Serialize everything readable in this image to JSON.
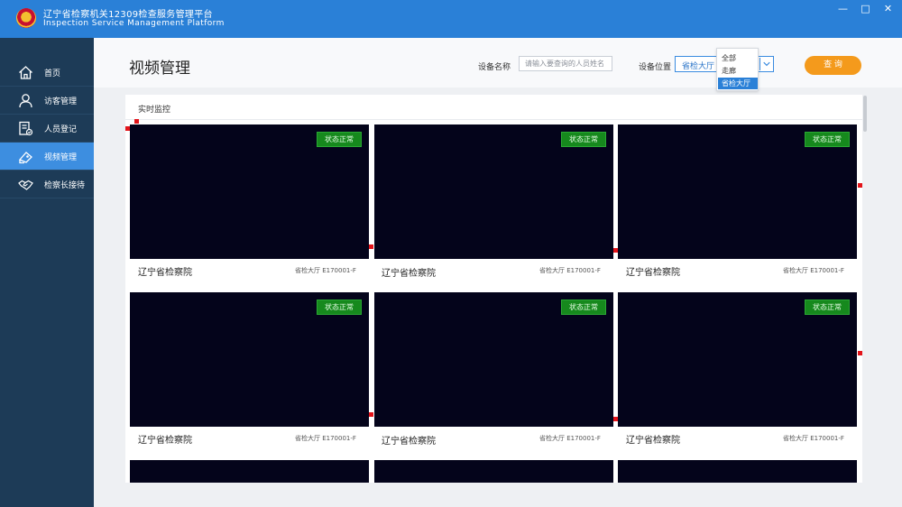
{
  "app": {
    "title_cn": "辽宁省检察机关12309检查服务管理平台",
    "title_en": "Inspection Service Management Platform",
    "window_controls": {
      "minimize": "—",
      "maximize": "□",
      "close": "✕"
    }
  },
  "sidebar": {
    "items": [
      {
        "label": "首页",
        "icon": "home-icon",
        "active": false
      },
      {
        "label": "访客管理",
        "icon": "user-icon",
        "active": false
      },
      {
        "label": "人员登记",
        "icon": "register-icon",
        "active": false
      },
      {
        "label": "视频管理",
        "icon": "video-icon",
        "active": true
      },
      {
        "label": "检察长接待",
        "icon": "handshake-icon",
        "active": false
      }
    ]
  },
  "page": {
    "title": "视频管理"
  },
  "filters": {
    "device_name_label": "设备名称",
    "device_name_placeholder": "请输入要查询的人员姓名",
    "location_label": "设备位置",
    "location_value": "省检大厅",
    "location_options": [
      "全部",
      "走廊",
      "省检大厅"
    ],
    "location_selected_index": 2,
    "query_button": "查 询"
  },
  "monitor": {
    "panel_title": "实时监控",
    "cameras": [
      {
        "status": "状态正常",
        "name": "辽宁省检察院",
        "location": "省检大厅  E170001-F"
      },
      {
        "status": "状态正常",
        "name": "辽宁省检察院",
        "location": "省检大厅  E170001-F"
      },
      {
        "status": "状态正常",
        "name": "辽宁省检察院",
        "location": "省检大厅  E170001-F"
      },
      {
        "status": "状态正常",
        "name": "辽宁省检察院",
        "location": "省检大厅  E170001-F"
      },
      {
        "status": "状态正常",
        "name": "辽宁省检察院",
        "location": "省检大厅  E170001-F"
      },
      {
        "status": "状态正常",
        "name": "辽宁省检察院",
        "location": "省检大厅  E170001-F"
      }
    ]
  },
  "colors": {
    "titlebar": "#2a80d7",
    "sidebar": "#1d3b57",
    "sidebar_active": "#3d8ee0",
    "query_button": "#f49a1c",
    "status_badge": "#16891d",
    "video_bg": "#04041b"
  }
}
